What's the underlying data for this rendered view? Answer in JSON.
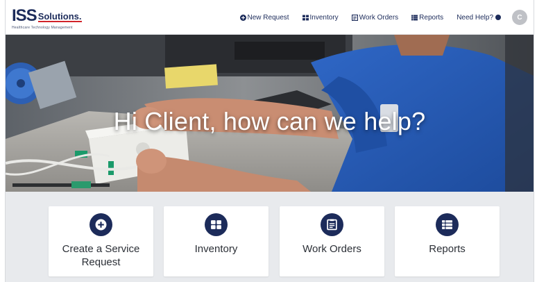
{
  "header": {
    "logo": {
      "main": "ISS",
      "sub": "Solutions.",
      "tagline": "Healthcare Technology Management"
    },
    "nav": [
      {
        "label": "New Request",
        "icon": "plus-circle-icon"
      },
      {
        "label": "Inventory",
        "icon": "grid-icon"
      },
      {
        "label": "Work Orders",
        "icon": "clipboard-icon"
      },
      {
        "label": "Reports",
        "icon": "list-icon"
      }
    ],
    "help": "Need Help?",
    "avatar_initial": "C"
  },
  "hero": {
    "title": "Hi Client, how can we help?"
  },
  "cards": [
    {
      "label": "Create a Service Request",
      "icon": "plus-circle-icon"
    },
    {
      "label": "Inventory",
      "icon": "grid-icon"
    },
    {
      "label": "Work Orders",
      "icon": "clipboard-icon"
    },
    {
      "label": "Reports",
      "icon": "list-icon"
    }
  ],
  "colors": {
    "brand": "#1c2b5a",
    "accent": "#d1232a",
    "cards_bg": "#e8eaed"
  }
}
